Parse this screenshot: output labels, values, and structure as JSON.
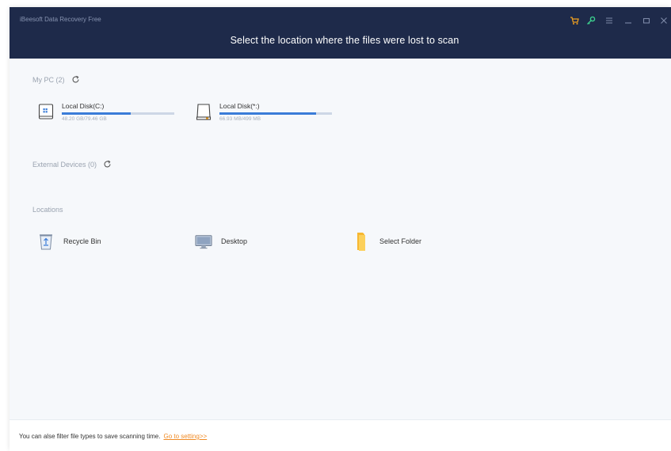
{
  "window": {
    "app_title": "iBeesoft Data Recovery Free",
    "headline": "Select the location where the files were lost to scan"
  },
  "titlebar_icons": [
    "cart-icon",
    "key-icon",
    "menu-icon",
    "minimize-icon",
    "maximize-icon",
    "close-icon"
  ],
  "my_pc": {
    "title": "My PC (2)",
    "disks": [
      {
        "name": "Local Disk(C:)",
        "size": "48.20 GB/79.46 GB",
        "used_fraction": 0.61
      },
      {
        "name": "Local Disk(*:)",
        "size": "66.93 MB/499 MB",
        "used_fraction": 0.86
      }
    ]
  },
  "external": {
    "title": "External Devices (0)"
  },
  "locations": {
    "title": "Locations",
    "items": [
      {
        "label": "Recycle Bin"
      },
      {
        "label": "Desktop"
      },
      {
        "label": "Select Folder"
      }
    ]
  },
  "footer": {
    "text": "You can alse filter file types to save scanning time.",
    "link": "Go to setting>>"
  },
  "colors": {
    "titlebar": "#1e2a4a",
    "accent": "#3a7cd8",
    "link": "#f08a24",
    "key": "#3ccf8e"
  }
}
